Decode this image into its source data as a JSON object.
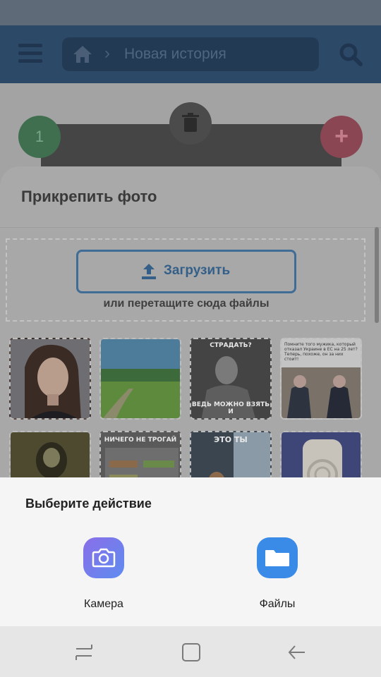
{
  "header": {
    "title": "Новая история",
    "breadcrumb_separator": "›"
  },
  "page": {
    "counter": "1",
    "add_symbol": "+"
  },
  "attach_sheet": {
    "title": "Прикрепить фото",
    "upload_label": "Загрузить",
    "drop_hint": "или перетащите сюда файлы",
    "thumbnails": [
      {
        "kind": "portrait"
      },
      {
        "kind": "landscape"
      },
      {
        "kind": "meme",
        "top_text": "СТРАДАТЬ?",
        "bottom_text": "ВЕДЬ МОЖНО ВЗЯТЬ И"
      },
      {
        "kind": "post",
        "caption": "Помните того мужика, который отказал Украине в ЕС на 25 лет? Теперь, похоже, он за них стоит!"
      },
      {
        "kind": "dark"
      },
      {
        "kind": "meme",
        "top_text": "НИЧЕГО НЕ ТРОГАЙ"
      },
      {
        "kind": "meme",
        "top_text": "ЭТО ТЫ"
      },
      {
        "kind": "object"
      }
    ]
  },
  "chooser": {
    "title": "Выберите действие",
    "actions": [
      {
        "label": "Камера",
        "icon": "camera-icon"
      },
      {
        "label": "Файлы",
        "icon": "folder-icon"
      }
    ]
  },
  "colors": {
    "accent": "#335f88",
    "header_bg": "#2c4a68",
    "chooser_bg": "#f5f5f5"
  }
}
